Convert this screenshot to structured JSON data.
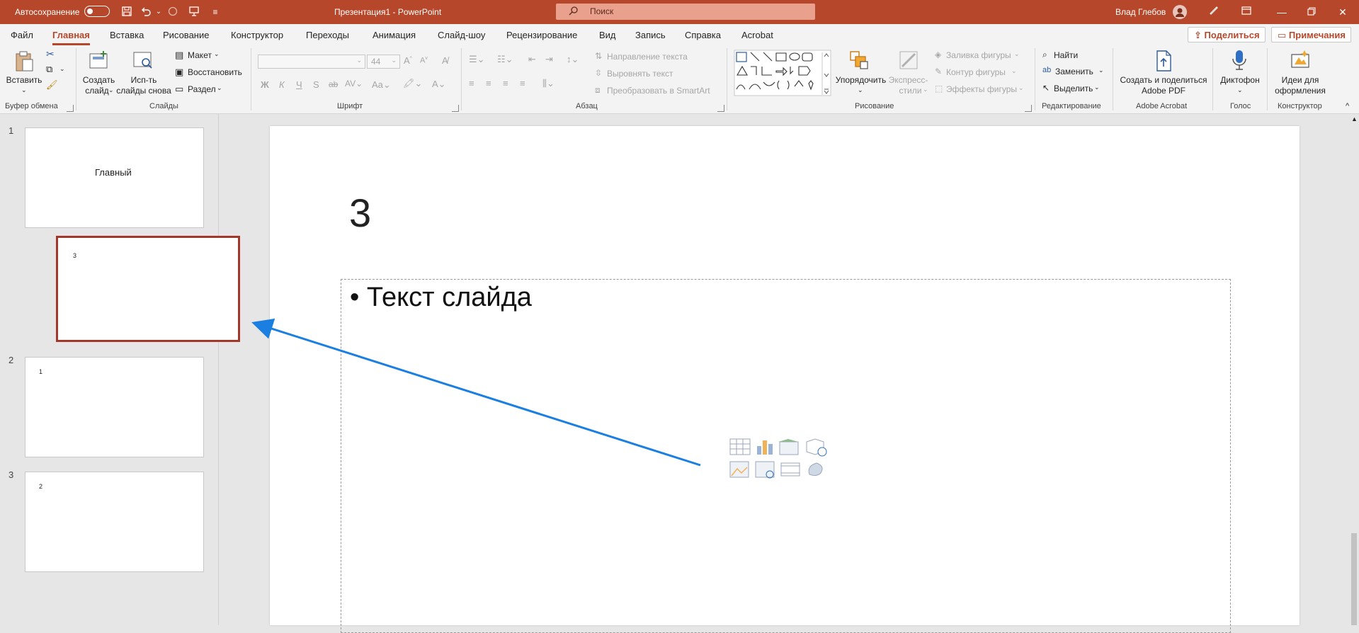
{
  "titlebar": {
    "autosave_label": "Автосохранение",
    "title": "Презентация1  -  PowerPoint",
    "search_placeholder": "Поиск",
    "user_name": "Влад Глебов"
  },
  "menu": {
    "tabs": [
      "Файл",
      "Главная",
      "Вставка",
      "Рисование",
      "Конструктор",
      "Переходы",
      "Анимация",
      "Слайд-шоу",
      "Рецензирование",
      "Вид",
      "Запись",
      "Справка",
      "Acrobat"
    ],
    "active_tab": "Главная",
    "share_label": "Поделиться",
    "comments_label": "Примечания"
  },
  "ribbon": {
    "clipboard": {
      "paste": "Вставить",
      "group": "Буфер обмена"
    },
    "slides": {
      "new_slide_1": "Создать",
      "new_slide_2": "слайд",
      "reuse_1": "Исп-ть",
      "reuse_2": "слайды снова",
      "layout": "Макет",
      "reset": "Восстановить",
      "section": "Раздел",
      "group": "Слайды"
    },
    "font": {
      "size": "44",
      "group": "Шрифт"
    },
    "paragraph": {
      "text_direction": "Направление текста",
      "align_text": "Выровнять текст",
      "smartart": "Преобразовать в SmartArt",
      "group": "Абзац"
    },
    "drawing": {
      "arrange": "Упорядочить",
      "quick_styles_1": "Экспресс-",
      "quick_styles_2": "стили",
      "fill": "Заливка фигуры",
      "outline": "Контур фигуры",
      "effects": "Эффекты фигуры",
      "group": "Рисование"
    },
    "editing": {
      "find": "Найти",
      "replace": "Заменить",
      "select": "Выделить",
      "group": "Редактирование"
    },
    "acrobat": {
      "create_1": "Создать и поделиться",
      "create_2": "Adobe PDF",
      "group": "Adobe Acrobat"
    },
    "voice": {
      "dictate": "Диктофон",
      "group": "Голос"
    },
    "designer": {
      "ideas_1": "Идеи для",
      "ideas_2": "оформления",
      "group": "Конструктор"
    }
  },
  "thumbnails": [
    {
      "number": "1",
      "text": "Главный"
    },
    {
      "number": "",
      "text": "3"
    },
    {
      "number": "2",
      "text": "1"
    },
    {
      "number": "3",
      "text": "2"
    }
  ],
  "slide": {
    "title": "3",
    "bullet": "Текст слайда"
  },
  "colors": {
    "accent": "#b7472a",
    "selection_border": "#a4372b",
    "arrow": "#1a7fe0"
  }
}
